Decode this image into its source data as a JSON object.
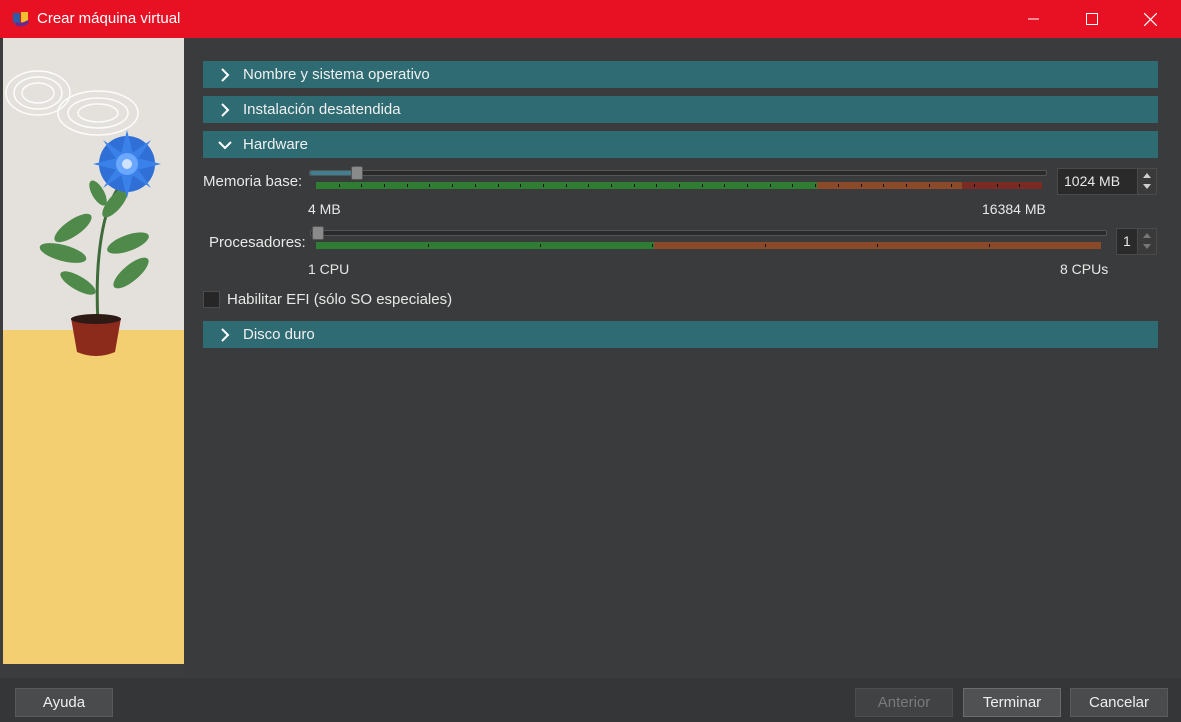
{
  "window": {
    "title": "Crear máquina virtual",
    "icons": [
      "app-logo-icon",
      "minimize-icon",
      "maximize-icon",
      "close-icon"
    ]
  },
  "sections": {
    "name_os": {
      "label": "Nombre y sistema operativo",
      "expanded": false
    },
    "unattended": {
      "label": "Instalación desatendida",
      "expanded": false
    },
    "hardware": {
      "label": "Hardware",
      "expanded": true
    },
    "disk": {
      "label": "Disco duro",
      "expanded": false
    }
  },
  "hardware": {
    "memory": {
      "label": "Memoria base:",
      "value": "1024 MB",
      "value_mb": 1024,
      "min_label": "4 MB",
      "max_label": "16384 MB",
      "min": 4,
      "max": 16384
    },
    "processors": {
      "label": "Procesadores:",
      "value": "1",
      "value_num": 1,
      "min_label": "1 CPU",
      "max_label": "8 CPUs",
      "min": 1,
      "max": 8
    },
    "efi": {
      "label": "Habilitar EFI (sólo SO especiales)",
      "checked": false
    }
  },
  "buttons": {
    "help": "Ayuda",
    "back": "Anterior",
    "finish": "Terminar",
    "cancel": "Cancelar"
  },
  "colors": {
    "titlebar": "#e81123",
    "section_header": "#2e6b73",
    "scale_green": "#2e7d32",
    "scale_orange": "#8a4a2a",
    "scale_red": "#7a2a22"
  }
}
